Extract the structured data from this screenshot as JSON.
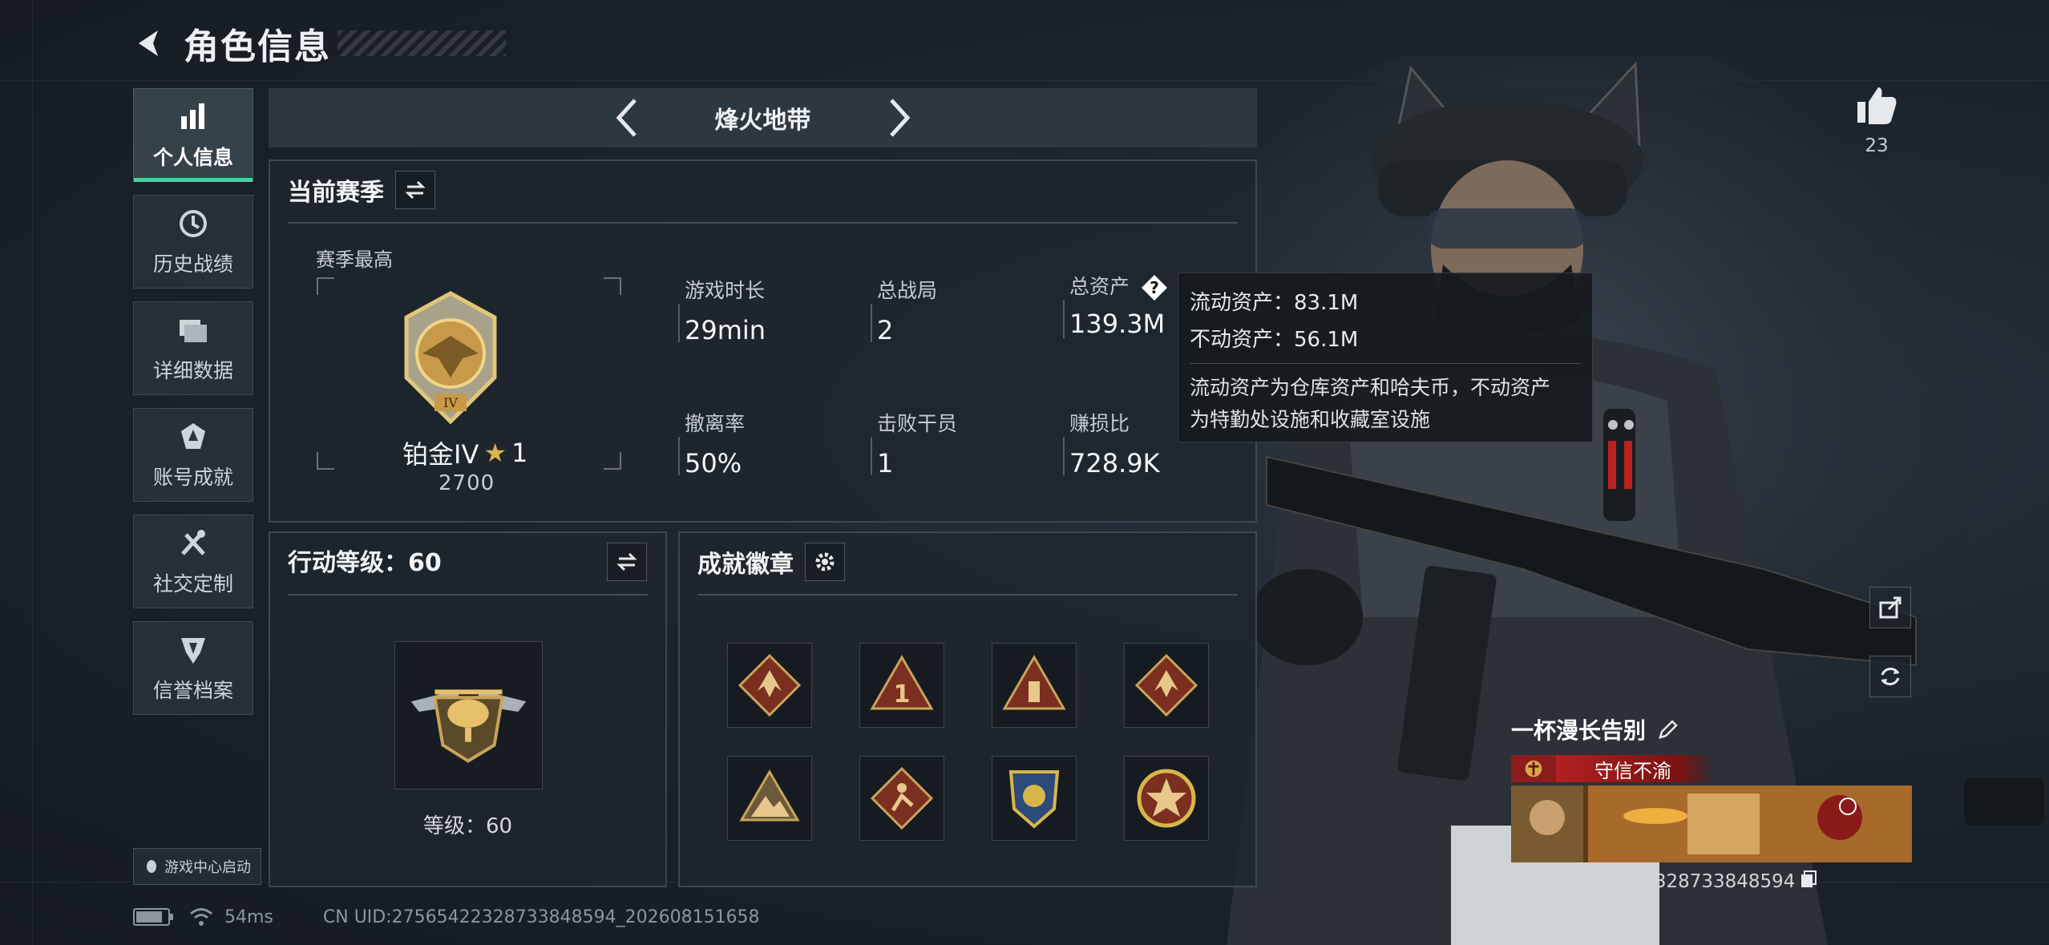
{
  "header": {
    "title": "角色信息",
    "back_icon": "back-arrow-icon"
  },
  "nav": {
    "items": [
      {
        "label": "个人信息",
        "icon": "bar-chart-icon",
        "active": true
      },
      {
        "label": "历史战绩",
        "icon": "clock-history-icon",
        "active": false
      },
      {
        "label": "详细数据",
        "icon": "folder-stack-icon",
        "active": false
      },
      {
        "label": "账号成就",
        "icon": "achievement-icon",
        "active": false
      },
      {
        "label": "社交定制",
        "icon": "tools-icon",
        "active": false
      },
      {
        "label": "信誉档案",
        "icon": "credit-shield-icon",
        "active": false
      }
    ],
    "launch_tag": "游戏中心启动"
  },
  "status": {
    "ping": "54ms",
    "uid": "CN UID:2756542232873384859​4_202608151658",
    "battery": 0.85
  },
  "mode": {
    "title": "烽火地带"
  },
  "season": {
    "title": "当前赛季",
    "subtitle": "赛季最高",
    "rank_name": "铂金IV",
    "rank_stars": "1",
    "rank_score": "2700",
    "stats": [
      {
        "label": "游戏时长",
        "value": "29min"
      },
      {
        "label": "总战局",
        "value": "2"
      },
      {
        "label": "总资产",
        "value": "139.3M"
      },
      {
        "label": "撤离率",
        "value": "50%"
      },
      {
        "label": "击败干员",
        "value": "1"
      },
      {
        "label": "赚损比",
        "value": "728.9K"
      }
    ]
  },
  "tooltip": {
    "liquid": "流动资产：83.1M",
    "fixed": "不动资产：56.1M",
    "desc_line1": "流动资产为仓库资产和哈夫币，不动资产",
    "desc_line2": "为特勤处设施和收藏室设施"
  },
  "action_level": {
    "title": "行动等级：60",
    "level_text": "等级：60"
  },
  "achievements": {
    "title": "成就徽章",
    "badges": [
      "dragon-badge-icon",
      "rank-one-badge-icon",
      "bullet-badge-icon",
      "dragon-badge-icon",
      "mountain-badge-icon",
      "runner-badge-icon",
      "shield-badge-icon",
      "star-badge-icon"
    ]
  },
  "side": {
    "likes": "23"
  },
  "card": {
    "name": "一杯漫长告别",
    "trust_label": "守信不渝",
    "id_text": "编号:27565422328733848594"
  },
  "colors": {
    "accent": "#3fd6a0",
    "trust_red": "#b32020",
    "gold": "#d8b64b"
  }
}
